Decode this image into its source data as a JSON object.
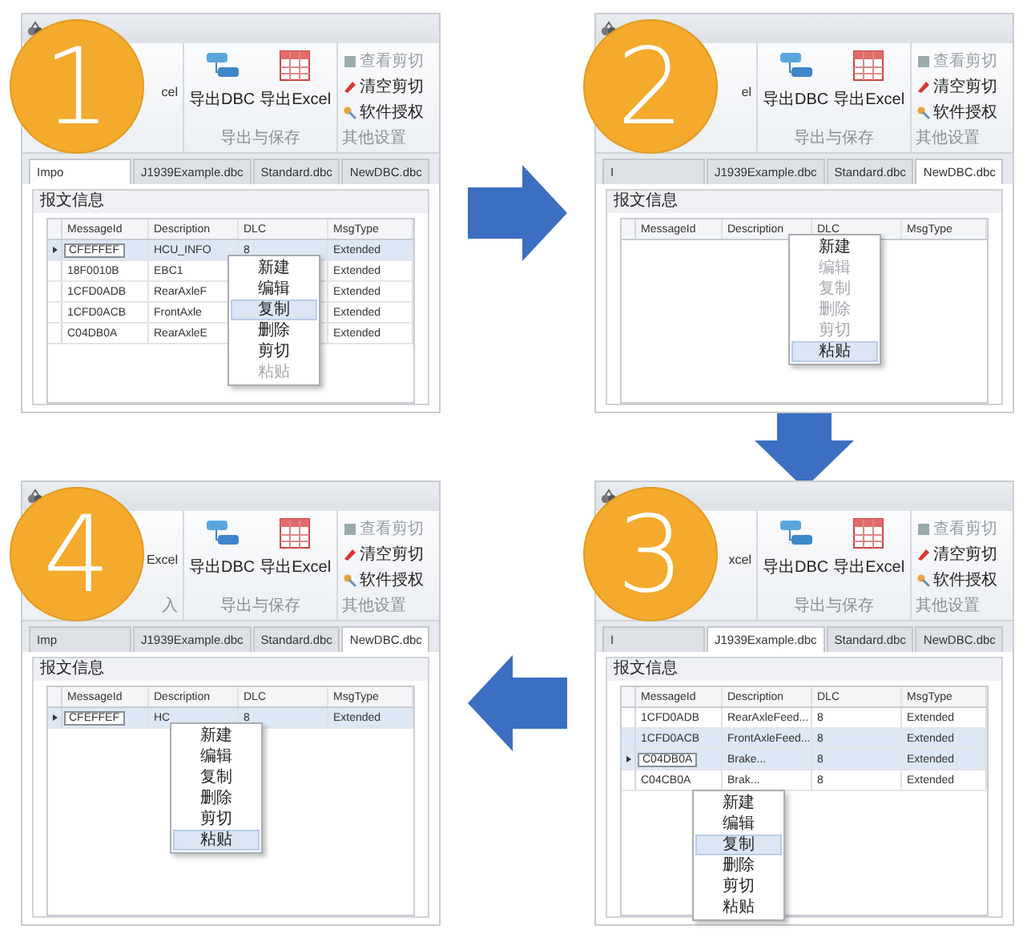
{
  "panels": [
    {
      "number": "1",
      "ribbon_fragment": "cel",
      "buttons": [
        "导出DBC",
        "导出Excel"
      ],
      "group_label": "导出与保存",
      "side_items": [
        {
          "label": "查看剪切",
          "disabled": true
        },
        {
          "label": "清空剪切",
          "disabled": false
        },
        {
          "label": "软件授权",
          "disabled": false
        }
      ],
      "side_label": "其他设置",
      "tabs": [
        {
          "label": "Impo",
          "selected": true
        },
        {
          "label": "J1939Example.dbc",
          "selected": false
        },
        {
          "label": "Standard.dbc",
          "selected": false
        },
        {
          "label": "NewDBC.dbc",
          "selected": false
        }
      ],
      "group_title": "报文信息",
      "columns": [
        "MessageId",
        "Description",
        "DLC",
        "MsgType"
      ],
      "rows": [
        {
          "cells": [
            "CFEFFEF",
            "HCU_INFO",
            "8",
            "Extended"
          ],
          "selected": true,
          "current": true
        },
        {
          "cells": [
            "18F0010B",
            "EBC1",
            "",
            "Extended"
          ],
          "selected": false,
          "current": false
        },
        {
          "cells": [
            "1CFD0ADB",
            "RearAxleF",
            "",
            "Extended"
          ],
          "selected": false,
          "current": false
        },
        {
          "cells": [
            "1CFD0ACB",
            "FrontAxle",
            "",
            "Extended"
          ],
          "selected": false,
          "current": false
        },
        {
          "cells": [
            "C04DB0A",
            "RearAxleE",
            "",
            "Extended"
          ],
          "selected": false,
          "current": false
        }
      ],
      "menu": [
        {
          "label": "新建",
          "disabled": false,
          "selected": false
        },
        {
          "label": "编辑",
          "disabled": false,
          "selected": false
        },
        {
          "label": "复制",
          "disabled": false,
          "selected": true
        },
        {
          "label": "删除",
          "disabled": false,
          "selected": false
        },
        {
          "label": "剪切",
          "disabled": false,
          "selected": false
        },
        {
          "label": "粘贴",
          "disabled": true,
          "selected": false
        }
      ]
    },
    {
      "number": "2",
      "ribbon_fragment": "el",
      "buttons": [
        "导出DBC",
        "导出Excel"
      ],
      "group_label": "导出与保存",
      "side_items": [
        {
          "label": "查看剪切",
          "disabled": true
        },
        {
          "label": "清空剪切",
          "disabled": false
        },
        {
          "label": "软件授权",
          "disabled": false
        }
      ],
      "side_label": "其他设置",
      "tabs": [
        {
          "label": "I",
          "selected": false
        },
        {
          "label": "J1939Example.dbc",
          "selected": false
        },
        {
          "label": "Standard.dbc",
          "selected": false
        },
        {
          "label": "NewDBC.dbc",
          "selected": true
        }
      ],
      "group_title": "报文信息",
      "columns": [
        "MessageId",
        "Description",
        "DLC",
        "MsgType"
      ],
      "menu": [
        {
          "label": "新建",
          "disabled": false,
          "selected": false
        },
        {
          "label": "编辑",
          "disabled": true,
          "selected": false
        },
        {
          "label": "复制",
          "disabled": true,
          "selected": false
        },
        {
          "label": "删除",
          "disabled": true,
          "selected": false
        },
        {
          "label": "剪切",
          "disabled": true,
          "selected": false
        },
        {
          "label": "粘贴",
          "disabled": false,
          "selected": true
        }
      ]
    },
    {
      "number": "4",
      "ribbon_fragment": "Excel",
      "group_fragment": "入",
      "buttons": [
        "导出DBC",
        "导出Excel"
      ],
      "group_label": "导出与保存",
      "side_items": [
        {
          "label": "查看剪切",
          "disabled": true
        },
        {
          "label": "清空剪切",
          "disabled": false
        },
        {
          "label": "软件授权",
          "disabled": false
        }
      ],
      "side_label": "其他设置",
      "tabs": [
        {
          "label": "Imp",
          "selected": false
        },
        {
          "label": "J1939Example.dbc",
          "selected": false
        },
        {
          "label": "Standard.dbc",
          "selected": false
        },
        {
          "label": "NewDBC.dbc",
          "selected": true
        }
      ],
      "group_title": "报文信息",
      "columns": [
        "MessageId",
        "Description",
        "DLC",
        "MsgType"
      ],
      "rows": [
        {
          "cells": [
            "CFEFFEF",
            "HC",
            "8",
            "Extended"
          ],
          "selected": true,
          "current": true
        }
      ],
      "menu": [
        {
          "label": "新建",
          "disabled": false,
          "selected": false
        },
        {
          "label": "编辑",
          "disabled": false,
          "selected": false
        },
        {
          "label": "复制",
          "disabled": false,
          "selected": false
        },
        {
          "label": "删除",
          "disabled": false,
          "selected": false
        },
        {
          "label": "剪切",
          "disabled": false,
          "selected": false
        },
        {
          "label": "粘贴",
          "disabled": false,
          "selected": true
        }
      ]
    },
    {
      "number": "3",
      "ribbon_fragment": "xcel",
      "buttons": [
        "导出DBC",
        "导出Excel"
      ],
      "group_label": "导出与保存",
      "side_items": [
        {
          "label": "查看剪切",
          "disabled": true
        },
        {
          "label": "清空剪切",
          "disabled": false
        },
        {
          "label": "软件授权",
          "disabled": false
        }
      ],
      "side_label": "其他设置",
      "tabs": [
        {
          "label": "I",
          "selected": false
        },
        {
          "label": "J1939Example.dbc",
          "selected": true
        },
        {
          "label": "Standard.dbc",
          "selected": false
        },
        {
          "label": "NewDBC.dbc",
          "selected": false
        }
      ],
      "group_title": "报文信息",
      "columns": [
        "MessageId",
        "Description",
        "DLC",
        "MsgType"
      ],
      "rows": [
        {
          "cells": [
            "1CFD0ADB",
            "RearAxleFeed...",
            "8",
            "Extended"
          ],
          "selected": false,
          "current": false
        },
        {
          "cells": [
            "1CFD0ACB",
            "FrontAxleFeed...",
            "8",
            "Extended"
          ],
          "selected": true,
          "current": false
        },
        {
          "cells": [
            "C04DB0A",
            "Brake...",
            "8",
            "Extended"
          ],
          "selected": true,
          "current": true
        },
        {
          "cells": [
            "C04CB0A",
            "Brak...",
            "8",
            "Extended"
          ],
          "selected": false,
          "current": false
        }
      ],
      "menu": [
        {
          "label": "新建",
          "disabled": false,
          "selected": false
        },
        {
          "label": "编辑",
          "disabled": false,
          "selected": false
        },
        {
          "label": "复制",
          "disabled": false,
          "selected": true
        },
        {
          "label": "删除",
          "disabled": false,
          "selected": false
        },
        {
          "label": "剪切",
          "disabled": false,
          "selected": false
        },
        {
          "label": "粘贴",
          "disabled": false,
          "selected": false
        }
      ]
    }
  ],
  "arrows": [
    {
      "kind": "right"
    },
    {
      "kind": "down"
    },
    {
      "kind": "left"
    }
  ]
}
